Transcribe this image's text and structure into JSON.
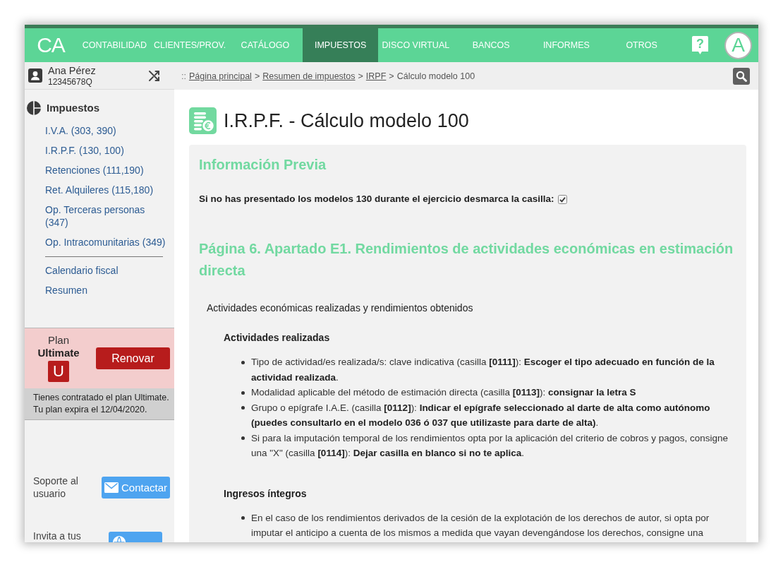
{
  "nav": {
    "logo": "CA",
    "items": [
      {
        "label": "CONTABILIDAD",
        "selected": false
      },
      {
        "label": "CLIENTES/PROV.",
        "selected": false
      },
      {
        "label": "CATÁLOGO",
        "selected": false
      },
      {
        "label": "IMPUESTOS",
        "selected": true
      },
      {
        "label": "DISCO VIRTUAL",
        "selected": false
      },
      {
        "label": "BANCOS",
        "selected": false
      },
      {
        "label": "INFORMES",
        "selected": false
      },
      {
        "label": "OTROS",
        "selected": false
      }
    ],
    "help": "?",
    "avatar": "A"
  },
  "user": {
    "name": "Ana Pérez",
    "id": "12345678Q"
  },
  "breadcrumb": {
    "prefix": "::",
    "crumbs": [
      {
        "label": "Página principal",
        "kind": "link"
      },
      {
        "label": "Resumen de impuestos",
        "kind": "link"
      },
      {
        "label": "IRPF",
        "kind": "link"
      },
      {
        "label": "Cálculo modelo 100",
        "kind": "current"
      }
    ],
    "separators": [
      ">",
      ">",
      ">"
    ]
  },
  "sidebar": {
    "title": "Impuestos",
    "groups": [
      {
        "links": [
          "I.V.A. (303, 390)",
          "I.R.P.F. (130, 100)",
          "Retenciones (111,190)",
          "Ret. Alquileres (115,180)",
          "Op. Terceras personas (347)",
          "Op. Intracomunitarias (349)"
        ]
      },
      {
        "links": [
          "Calendario fiscal",
          "Resumen"
        ]
      }
    ]
  },
  "plan": {
    "label": "Plan",
    "name": "Ultimate",
    "badge": "U",
    "button": "Renovar",
    "notes": [
      "Tienes contratado el plan Ultimate.",
      "Tu plan expira el 12/04/2020."
    ]
  },
  "support": {
    "label": "Soporte al usuario",
    "button": "Contactar"
  },
  "invite": {
    "label": "Invita a tus"
  },
  "page": {
    "title": "I.R.P.F. - Cálculo modelo 100"
  },
  "info": {
    "heading": "Información Previa",
    "question": "Si no has presentado los modelos 130 durante el ejercicio desmarca la casilla:",
    "checked": true
  },
  "section": {
    "heading": "Página 6. Apartado E1. Rendimientos de actividades económicas en estimación directa",
    "subheading": "Actividades económicas realizadas y rendimientos obtenidos",
    "groups": [
      {
        "title": "Actividades realizadas",
        "bullets": [
          "Tipo de actividad/es realizada/s: clave indicativa (casilla **[0111]**): **Escoger el tipo adecuado en función de la actividad realizada**.",
          "Modalidad aplicable del método de estimación directa (casilla **[0113]**): **consignar la letra S**",
          "Grupo o epígrafe I.A.E. (casilla **[0112]**): **Indicar el epígrafe seleccionado al darte de alta como autónomo (puedes consultarlo en el modelo 036 ó 037 que utilizaste para darte de alta)**.",
          "Si para la imputación temporal de los rendimientos opta por la aplicación del criterio de cobros y pagos, consigne una \"X\" (casilla **[0114]**): **Dejar casilla en blanco si no te aplica**."
        ]
      },
      {
        "title": "Ingresos íntegros",
        "bullets": [
          "En el caso de los rendimientos derivados de la cesión de la explotación de los derechos de autor, si opta por imputar el anticipo a cuenta de los mismos a medida que vayan devengándose los derechos, consigne una"
        ]
      }
    ]
  }
}
